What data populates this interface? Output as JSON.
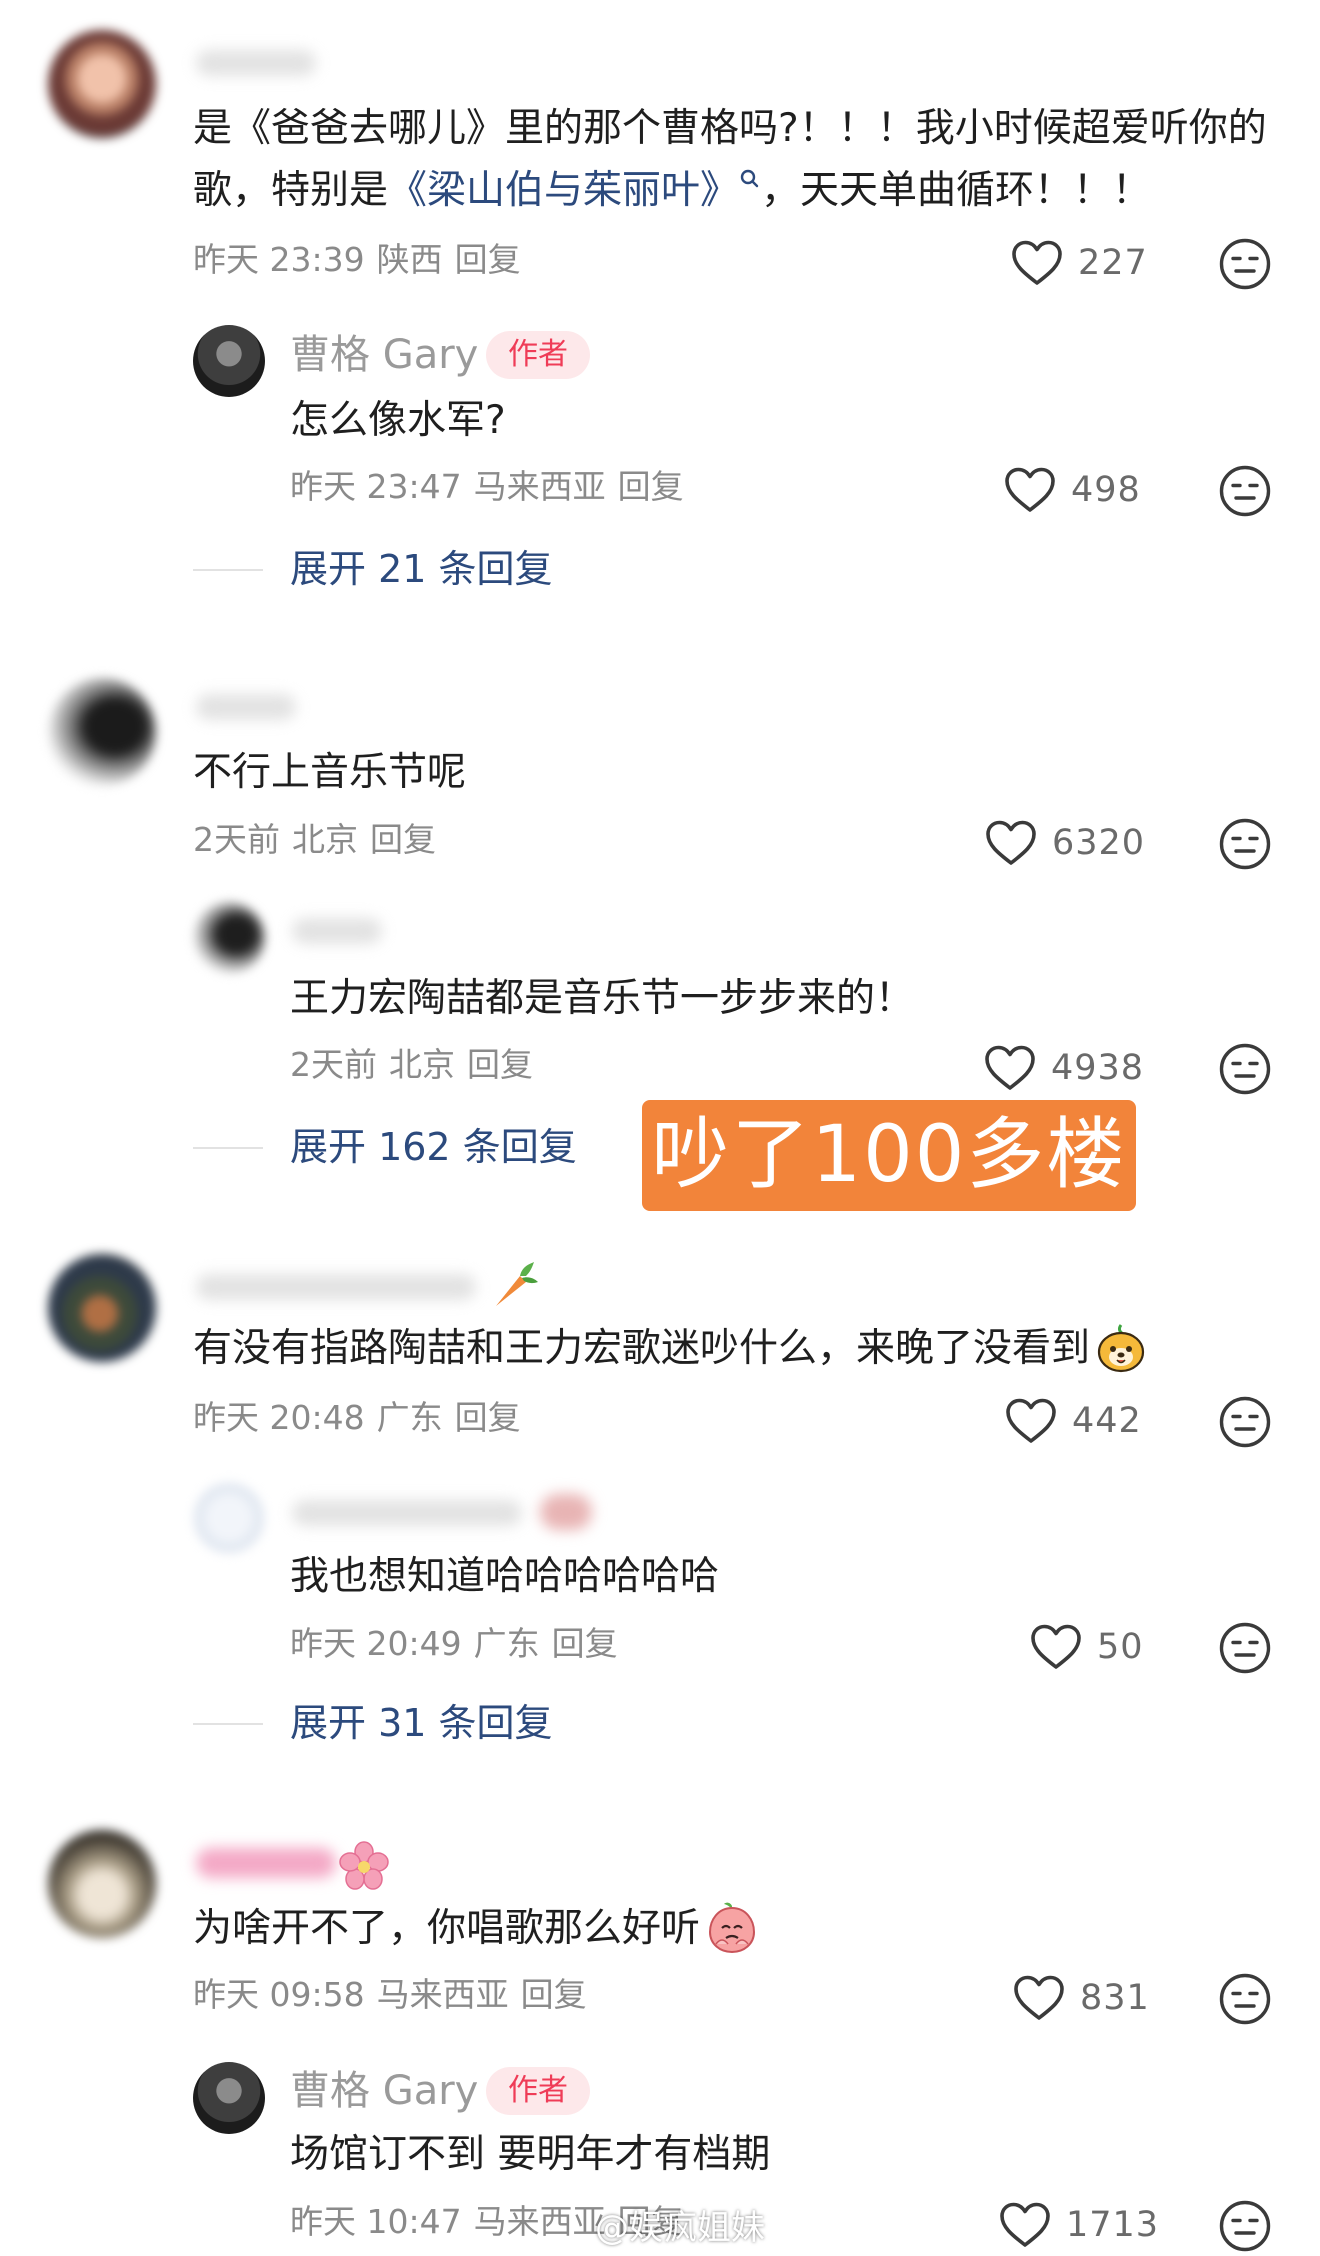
{
  "comments": [
    {
      "text_plain": "是《爸爸去哪儿》里的那个曹格吗?！！！我小时候超爱听你的歌，特别是",
      "text_link": "《梁山伯与茱丽叶》",
      "text_after": "，天天单曲循环！！！",
      "time": "昨天 23:39",
      "location": "陕西",
      "reply_label": "回复",
      "likes": "227",
      "reply": {
        "username": "曹格 Gary",
        "badge": "作者",
        "text": "怎么像水军?",
        "time": "昨天 23:47",
        "location": "马来西亚",
        "reply_label": "回复",
        "likes": "498"
      },
      "expand": "展开 21 条回复"
    },
    {
      "text": "不行上音乐节呢",
      "time": "2天前",
      "location": "北京",
      "reply_label": "回复",
      "likes": "6320",
      "reply": {
        "text": "王力宏陶喆都是音乐节一步步来的！",
        "time": "2天前",
        "location": "北京",
        "reply_label": "回复",
        "likes": "4938"
      },
      "expand": "展开 162 条回复"
    },
    {
      "text": "有没有指路陶喆和王力宏歌迷吵什么，来晚了没看到",
      "time": "昨天 20:48",
      "location": "广东",
      "reply_label": "回复",
      "likes": "442",
      "reply": {
        "text": "我也想知道哈哈哈哈哈哈",
        "time": "昨天 20:49",
        "location": "广东",
        "reply_label": "回复",
        "likes": "50"
      },
      "expand": "展开 31 条回复"
    },
    {
      "text": "为啥开不了，你唱歌那么好听",
      "time": "昨天 09:58",
      "location": "马来西亚",
      "reply_label": "回复",
      "likes": "831",
      "reply": {
        "username": "曹格 Gary",
        "badge": "作者",
        "text": "场馆订不到 要明年才有档期",
        "time": "昨天 10:47",
        "location": "马来西亚",
        "reply_label": "回复",
        "likes": "1713"
      }
    }
  ],
  "overlay_caption": "吵了100多楼",
  "watermark": "@娱疯姐妹",
  "colors": {
    "link": "#2c4a7d",
    "badge_bg": "#fde8ea",
    "badge_text": "#ef3c57",
    "overlay": "#f2843a",
    "meta": "#8a8a8a"
  },
  "icons": [
    "heart-outline-icon",
    "meh-face-icon",
    "search-link-icon",
    "carrot-emoji",
    "dog-emoji",
    "flower-emoji",
    "peach-emoji"
  ]
}
